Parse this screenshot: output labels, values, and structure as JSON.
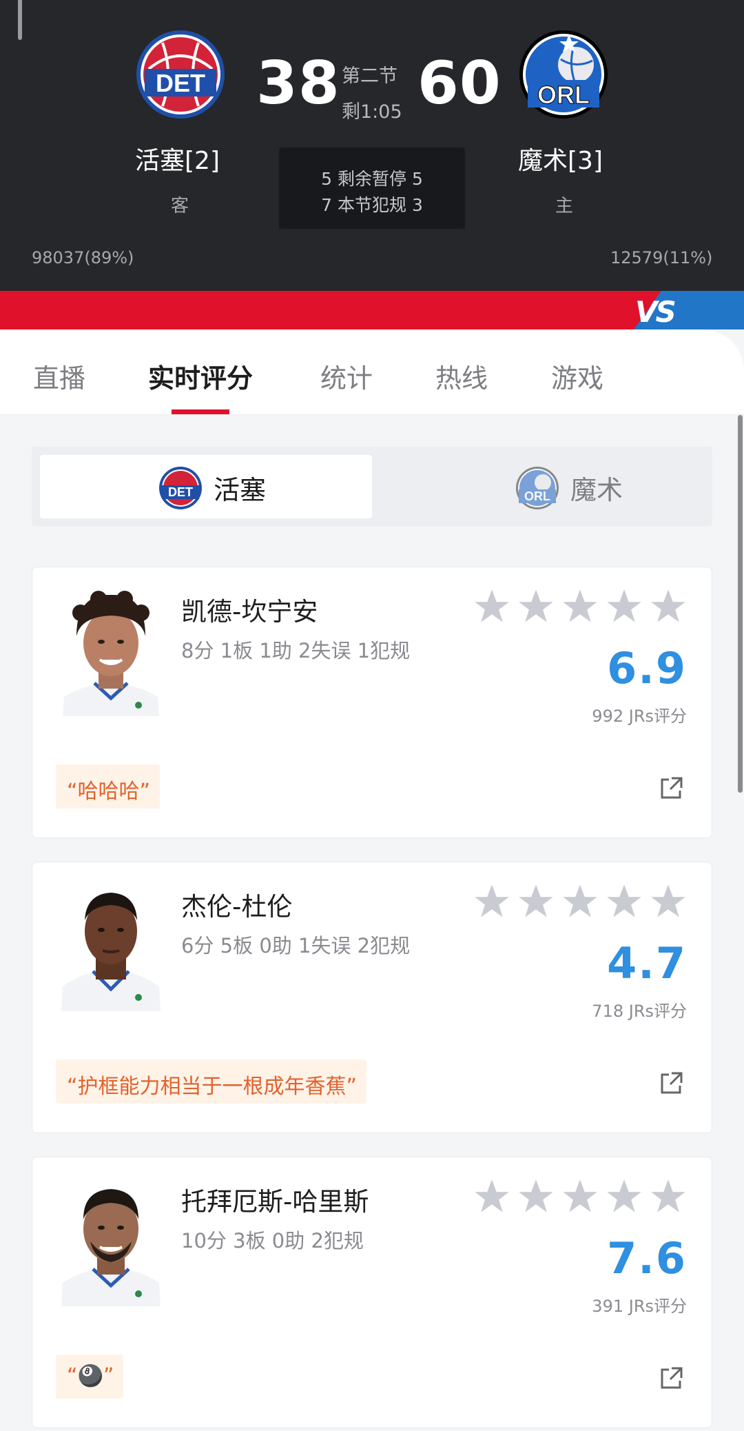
{
  "scoreboard": {
    "away": {
      "abbr": "DET",
      "name": "活塞[2]",
      "role": "客",
      "score": "38",
      "support": "98037(89%)",
      "color": "#d32339"
    },
    "home": {
      "abbr": "ORL",
      "name": "魔术[3]",
      "role": "主",
      "score": "60",
      "support": "12579(11%)",
      "color": "#1e63c4"
    },
    "period": "第二节",
    "clock": "剩1:05",
    "timeouts_line": "5 剩余暂停 5",
    "fouls_line": "7 本节犯规 3",
    "vs_text": "VS"
  },
  "tabs": [
    {
      "label": "直播"
    },
    {
      "label": "实时评分"
    },
    {
      "label": "统计"
    },
    {
      "label": "热线"
    },
    {
      "label": "游戏"
    }
  ],
  "active_tab": "实时评分",
  "team_toggle": {
    "selected": {
      "label": "活塞",
      "logo": "DET"
    },
    "other": {
      "label": "魔术",
      "logo": "ORL"
    }
  },
  "players": [
    {
      "name": "凯德-坎宁安",
      "stats": "8分 1板 1助 2失误 1犯规",
      "rating": "6.9",
      "votes": "992 JRs评分",
      "comment": "“哈哈哈”"
    },
    {
      "name": "杰伦-杜伦",
      "stats": "6分 5板 0助 1失误 2犯规",
      "rating": "4.7",
      "votes": "718 JRs评分",
      "comment": "“护框能力相当于一根成年香蕉”"
    },
    {
      "name": "托拜厄斯-哈里斯",
      "stats": "10分 3板 0助 2犯规",
      "rating": "7.6",
      "votes": "391 JRs评分",
      "comment": "“🎱”"
    }
  ],
  "colors": {
    "accent_red": "#e0112b",
    "rating_blue": "#2f8fe0",
    "comment_orange": "#e2622d",
    "header_bg": "#26272b"
  },
  "icons": {
    "star": "star-icon",
    "share": "share-icon"
  }
}
